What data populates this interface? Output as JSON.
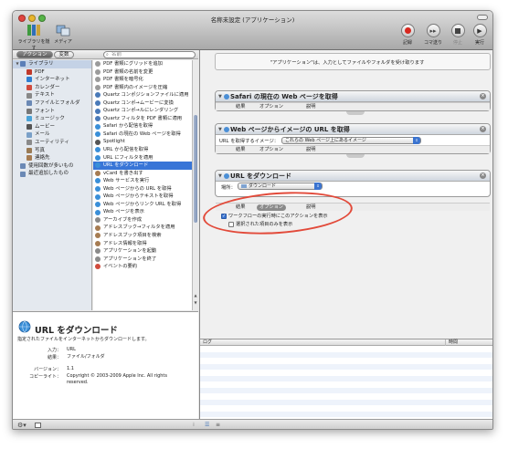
{
  "window": {
    "title": "名称未設定 (アプリケーション)"
  },
  "toolbar": {
    "left_buttons": [
      {
        "label": "ライブラリを隠す",
        "icon": "library-icon"
      },
      {
        "label": "メディア",
        "icon": "media-icon"
      }
    ],
    "right_buttons": [
      {
        "label": "記録",
        "icon": "record-icon"
      },
      {
        "label": "コマ送り",
        "icon": "step-icon"
      },
      {
        "label": "停止",
        "icon": "stop-icon"
      },
      {
        "label": "実行",
        "icon": "run-icon"
      }
    ]
  },
  "library": {
    "tabs": [
      {
        "label": "アクション",
        "active": true
      },
      {
        "label": "変数",
        "active": false
      }
    ],
    "search_placeholder": "名前",
    "categories": [
      {
        "label": "ライブラリ",
        "level": 0,
        "selected": true,
        "color": "#5b7fb8"
      },
      {
        "label": "PDF",
        "level": 1,
        "color": "#c0392b"
      },
      {
        "label": "インターネット",
        "level": 1,
        "color": "#2f7fd1"
      },
      {
        "label": "カレンダー",
        "level": 1,
        "color": "#d04b3d"
      },
      {
        "label": "テキスト",
        "level": 1,
        "color": "#888888"
      },
      {
        "label": "ファイルとフォルダ",
        "level": 1,
        "color": "#6b89b5"
      },
      {
        "label": "フォント",
        "level": 1,
        "color": "#777777"
      },
      {
        "label": "ミュージック",
        "level": 1,
        "color": "#4aa3d8"
      },
      {
        "label": "ムービー",
        "level": 1,
        "color": "#555555"
      },
      {
        "label": "メール",
        "level": 1,
        "color": "#7aa0c8"
      },
      {
        "label": "ユーティリティ",
        "level": 1,
        "color": "#8a8a8a"
      },
      {
        "label": "写真",
        "level": 1,
        "color": "#9a7b55"
      },
      {
        "label": "連絡先",
        "level": 1,
        "color": "#a67c52"
      },
      {
        "label": "使用回数が多いもの",
        "level": 0,
        "color": "#6b89b5"
      },
      {
        "label": "最近追加したもの",
        "level": 0,
        "color": "#6b89b5"
      }
    ],
    "actions": [
      {
        "label": "PDF 書類にグリッドを追加",
        "color": "#9b9b9b"
      },
      {
        "label": "PDF 書類の名前を変更",
        "color": "#9b9b9b"
      },
      {
        "label": "PDF 書類を暗号化",
        "color": "#9b9b9b"
      },
      {
        "label": "PDF 書類内のイメージを圧縮",
        "color": "#9b9b9b"
      },
      {
        "label": "Quartz コンポジションファイルに適用",
        "color": "#4a7ab8"
      },
      {
        "label": "Quartz コンポ→ムービーに変換",
        "color": "#4a7ab8"
      },
      {
        "label": "Quartz コンポ→ルにレンダリング",
        "color": "#4a7ab8"
      },
      {
        "label": "Quartz フィルタを PDF 書類に適用",
        "color": "#4a7ab8"
      },
      {
        "label": "Safari から配信を取得",
        "color": "#3a8fd8"
      },
      {
        "label": "Safari の現在の Web ページを取得",
        "color": "#3a8fd8"
      },
      {
        "label": "Spotlight",
        "color": "#555555"
      },
      {
        "label": "URL から配信を取得",
        "color": "#3a8fd8"
      },
      {
        "label": "URL にフィルタを適用",
        "color": "#3a8fd8"
      },
      {
        "label": "URL をダウンロード",
        "color": "#3a8fd8",
        "selected": true
      },
      {
        "label": "vCard を書き出す",
        "color": "#a67c52"
      },
      {
        "label": "Web サービスを実行",
        "color": "#3a8fd8"
      },
      {
        "label": "Web ページからの URL を取得",
        "color": "#3a8fd8"
      },
      {
        "label": "Web ページからテキストを取得",
        "color": "#3a8fd8"
      },
      {
        "label": "Web ページからリンク URL を取得",
        "color": "#3a8fd8"
      },
      {
        "label": "Web ページを表示",
        "color": "#3a8fd8"
      },
      {
        "label": "アーカイブを作成",
        "color": "#8a8a8a"
      },
      {
        "label": "アドレスブック→フィルタを適用",
        "color": "#a67c52"
      },
      {
        "label": "アドレスブック項目を検索",
        "color": "#a67c52"
      },
      {
        "label": "アドレス情報を取得",
        "color": "#a67c52"
      },
      {
        "label": "アプリケーションを起動",
        "color": "#8a8a8a"
      },
      {
        "label": "アプリケーションを終了",
        "color": "#8a8a8a"
      },
      {
        "label": "イベントの要約",
        "color": "#d04b3d"
      }
    ]
  },
  "description": {
    "title": "URL をダウンロード",
    "summary": "指定されたファイルをインターネットからダウンロードします。",
    "input_label": "入力：",
    "input_value": "URL",
    "result_label": "結果：",
    "result_value": "ファイル/フォルダ",
    "version_label": "バージョン：",
    "version_value": "1.1",
    "copyright_label": "コピーライト：",
    "copyright_value": "Copyright © 2003-2009 Apple Inc. All rights reserved."
  },
  "workflow": {
    "message": "\"アプリケーション\"は、入力としてファイルやフォルダを受け取ります",
    "actions": [
      {
        "title": "Safari の現在の Web ページを取得",
        "foot": [
          "結果",
          "オプション",
          "説明"
        ]
      },
      {
        "title": "Web ページからイメージの URL を取得",
        "field_label": "URL を取得するイメージ：",
        "field_value": "これらの Web ページ上にあるイメージ",
        "foot": [
          "結果",
          "オプション",
          "説明"
        ]
      },
      {
        "title": "URL をダウンロード",
        "field_label": "場所：",
        "field_value": "ダウンロード",
        "foot": [
          "結果",
          "オプション",
          "説明"
        ],
        "option_show": "ワークフローの実行時にこのアクションを表示",
        "option_show_checked": true,
        "option_selected_only": "選択された項目のみを表示",
        "option_selected_only_checked": false
      }
    ]
  },
  "log": {
    "col_log": "ログ",
    "col_time": "時間"
  },
  "colors": {
    "selection": "#3875d7",
    "highlight_ring": "#e24a3a"
  }
}
